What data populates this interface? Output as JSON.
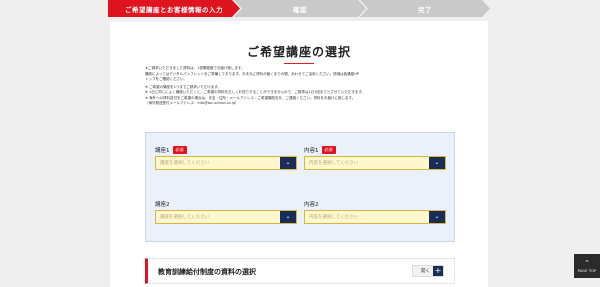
{
  "steps": [
    {
      "label": "ご希望講座とお客様情報の入力",
      "state": "active"
    },
    {
      "label": "確認",
      "state": "inactive"
    },
    {
      "label": "完了",
      "state": "inactive"
    }
  ],
  "page_title": "ご希望講座の選択",
  "notes": [
    "★ご請求いただきました資料は、1週間程度でお届け致します。",
    "講座によってはデジタルパンフレットをご準備しております。お手元に資料が届くまでの間、あわせてご活用ください。詳細は各講座HP",
    "トップをご確認ください。",
    "※ ご希望の講座を2つまでご請求いただけます。",
    "※ 1日に同じによく講座いただくと、ご希望の資料を正しくお送りすることができませんので、ご請求は1日1回までとさせていただきます。",
    "※ 海外への資料送付をご希望の場合は、氏名・住所・メールアドレス・ご希望講座名を、ご連絡ください。資料をお届けに致します。",
    "（海外発送受付メールアドレス：info@tac-school.co.jp）"
  ],
  "form": {
    "fields": [
      {
        "label": "講座1",
        "required_badge": "必須",
        "placeholder": "講座を選択してください"
      },
      {
        "label": "内容1",
        "required_badge": "必須",
        "placeholder": "内容を選択してください"
      },
      {
        "label": "講座2",
        "required_badge": "",
        "placeholder": "講座を選択してください"
      },
      {
        "label": "内容2",
        "required_badge": "",
        "placeholder": "内容を選択してください"
      }
    ]
  },
  "subsidy": {
    "title": "教育訓練給付制度の資料の選択",
    "open_label": "開く",
    "open_icon": "+"
  },
  "page_top": {
    "label": "PAGE TOP",
    "icon": "chevron-up-icon"
  },
  "colors": {
    "accent_red": "#e0141e",
    "navy": "#1a2c58",
    "select_bg": "#fff8cf",
    "form_bg": "#eaf1fa"
  }
}
